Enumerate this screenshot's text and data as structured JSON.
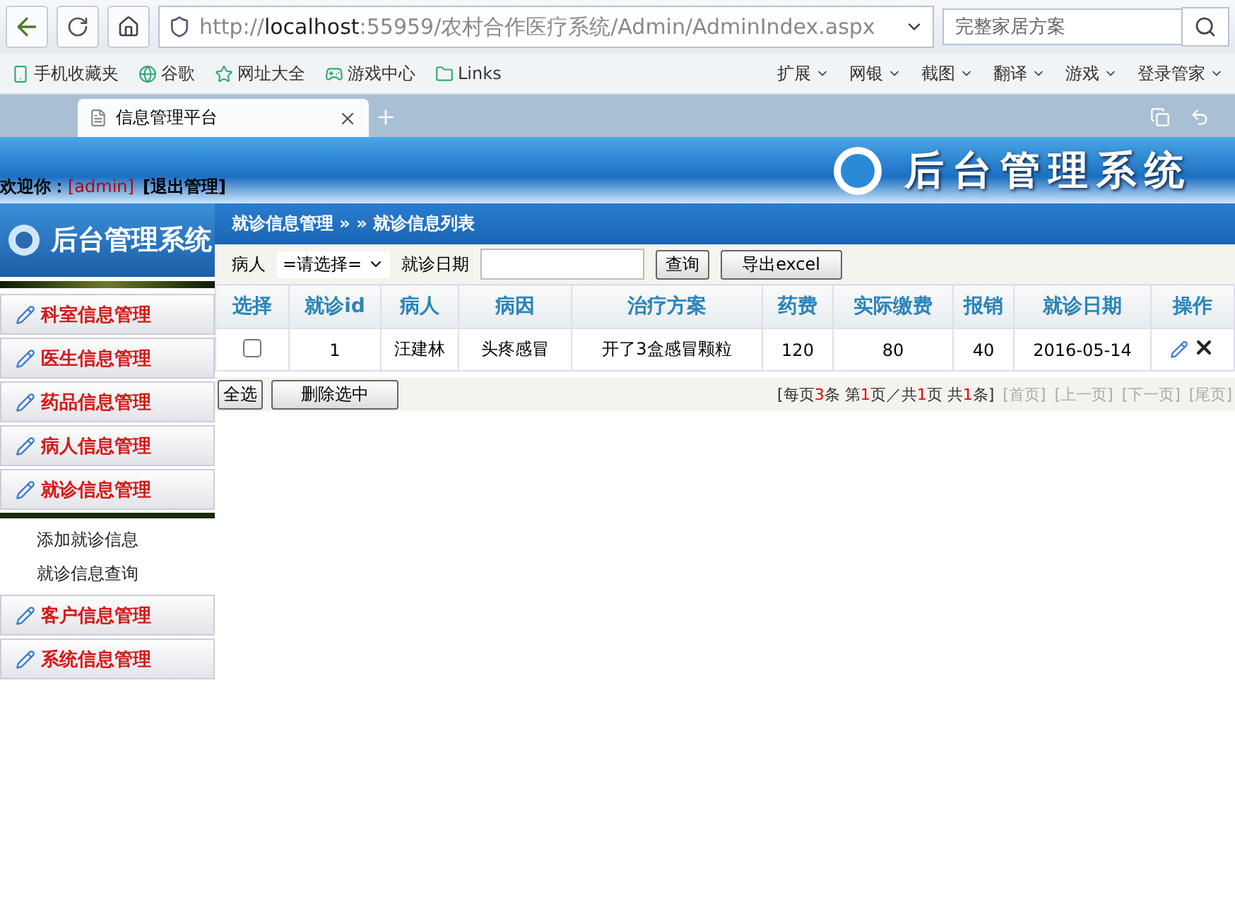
{
  "browser": {
    "url": "http://**localhost**:55959/农村合作医疗系统/Admin/AdminIndex.aspx",
    "search_placeholder": "完整家居方案",
    "bookmarks": [
      "手机收藏夹",
      "谷歌",
      "网址大全",
      "游戏中心",
      "Links"
    ],
    "tools": [
      "扩展",
      "网银",
      "截图",
      "翻译",
      "游戏",
      "登录管家"
    ],
    "tabs": [
      {
        "label": "信息管理平台",
        "selected": true
      }
    ]
  },
  "header": {
    "title": "后台管理系统",
    "welcome": "欢迎你：",
    "user": "[admin]",
    "logout": "[退出管理]"
  },
  "sidebar": {
    "title": "后台管理系统",
    "items": [
      {
        "label": "科室信息管理"
      },
      {
        "label": "医生信息管理"
      },
      {
        "label": "药品信息管理"
      },
      {
        "label": "病人信息管理"
      },
      {
        "label": "就诊信息管理",
        "children": [
          "添加就诊信息",
          "就诊信息查询"
        ]
      },
      {
        "label": "客户信息管理"
      },
      {
        "label": "系统信息管理"
      }
    ]
  },
  "breadcrumb": "就诊信息管理 » » 就诊信息列表",
  "filter": {
    "patient_label": "病人",
    "patient_select": "=请选择=",
    "date_label": "就诊日期",
    "buttons": [
      "查询",
      "导出excel"
    ]
  },
  "table": {
    "columns": [
      "选择",
      "就诊id",
      "病人",
      "病因",
      "治疗方案",
      "药费",
      "实际缴费",
      "报销",
      "就诊日期",
      "操作"
    ],
    "rows": [
      {
        "checked": false,
        "cells": [
          "",
          "1",
          "汪建林",
          "头疼感冒",
          "开了3盒感冒颗粒",
          "120",
          "80",
          "40",
          "2016-05-14",
          ""
        ]
      }
    ]
  },
  "footer": {
    "select_all": "全选",
    "delete": "删除选中",
    "pager": [
      {
        "text": "[每页",
        "highlight": false
      },
      {
        "text": "3",
        "highlight": true
      },
      {
        "text": "条 第",
        "highlight": false
      },
      {
        "text": "1",
        "highlight": true
      },
      {
        "text": "页／共",
        "highlight": false
      },
      {
        "text": "1",
        "highlight": true
      },
      {
        "text": "页 共",
        "highlight": false
      },
      {
        "text": "1",
        "highlight": true
      },
      {
        "text": "条]",
        "highlight": false
      }
    ],
    "links": [
      {
        "label": "[首页]",
        "disabled": true
      },
      {
        "label": "[上一页]",
        "disabled": true
      },
      {
        "label": "[下一页]",
        "disabled": true
      },
      {
        "label": "[尾页]",
        "disabled": true
      }
    ]
  }
}
